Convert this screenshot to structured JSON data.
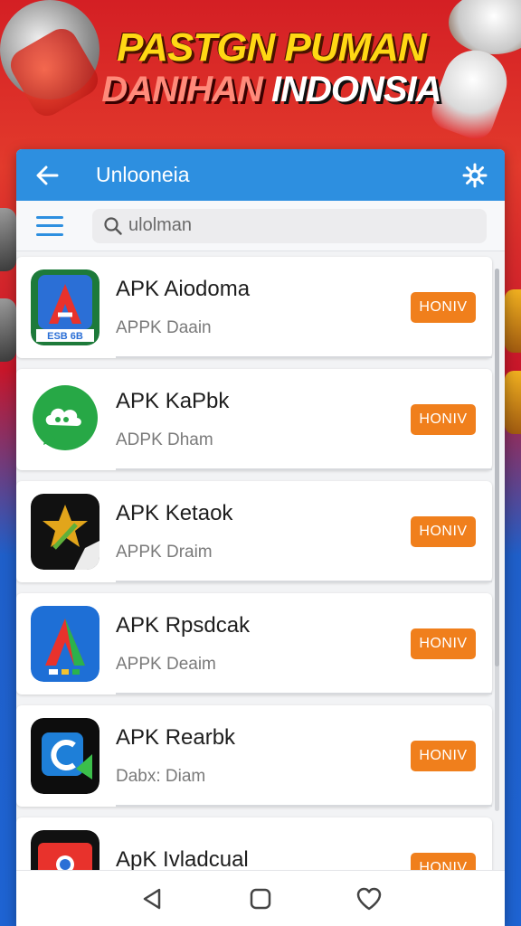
{
  "banner": {
    "line1": "PASTGN PUMAN",
    "line2_a": "DANIHAN",
    "line2_b": "INDONSIA"
  },
  "appbar": {
    "title": "Unlooneia",
    "back_icon": "arrow-left-icon",
    "settings_icon": "gear-icon"
  },
  "search": {
    "menu_icon": "hamburger-menu-icon",
    "search_icon": "search-icon",
    "value": "ulolman"
  },
  "apps": [
    {
      "name": "APK Aiodoma",
      "sub": "APPK Daain",
      "button": "HONIV",
      "icon": "red-green-blue-a-icon",
      "icon_label": "ESB 6B"
    },
    {
      "name": "APK KaPbk",
      "sub": "ADPK Dham",
      "button": "HONIV",
      "icon": "green-chat-cloud-icon"
    },
    {
      "name": "APK Ketaok",
      "sub": "APPK Draim",
      "button": "HONIV",
      "icon": "black-gold-star-icon"
    },
    {
      "name": "APK Rpsdcak",
      "sub": "APPK Deaim",
      "button": "HONIV",
      "icon": "blue-a-icon"
    },
    {
      "name": "APK Rearbk",
      "sub": "Dabx: Diam",
      "button": "HONIV",
      "icon": "green-c-icon"
    },
    {
      "name": "ApK Ivladcual",
      "sub": "",
      "button": "HONIV",
      "icon": "chrome-style-icon"
    }
  ],
  "navbar": {
    "back_icon": "triangle-back-icon",
    "home_icon": "square-home-icon",
    "heart_icon": "heart-icon"
  },
  "colors": {
    "accent": "#2d8fe0",
    "button": "#f07f1c",
    "banner_yellow": "#ffd814"
  }
}
